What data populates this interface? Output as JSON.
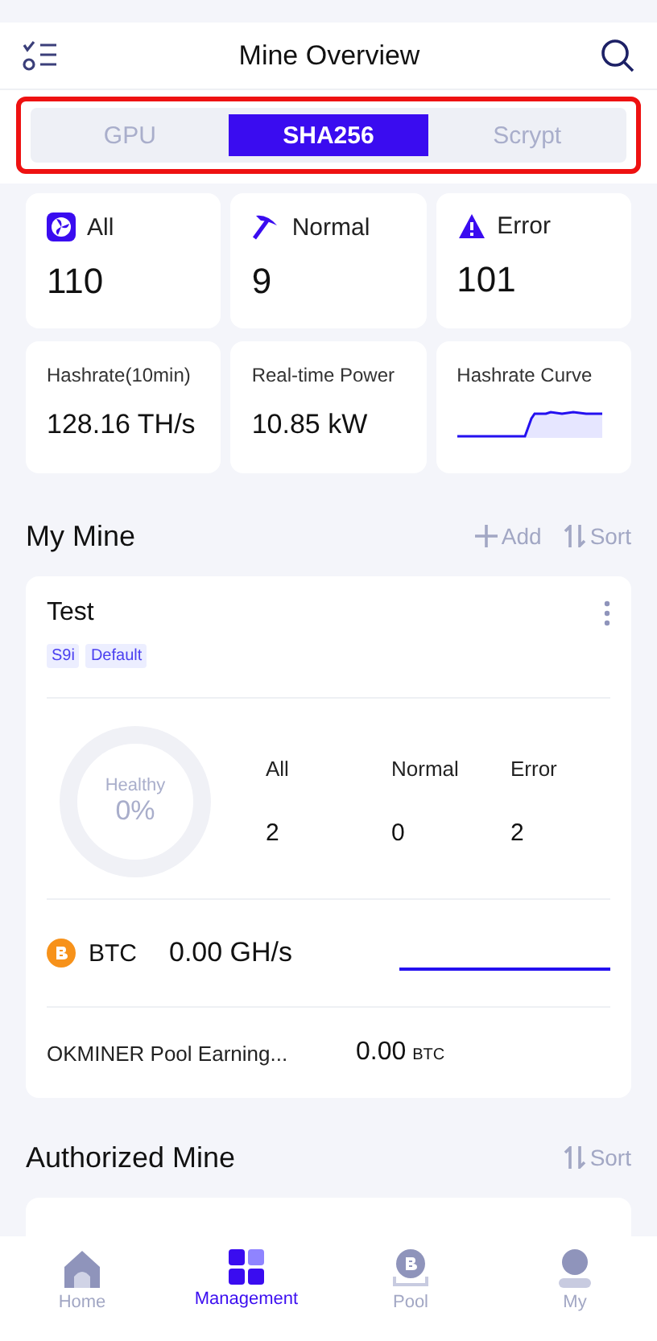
{
  "header": {
    "title": "Mine Overview"
  },
  "tabs": [
    {
      "label": "GPU",
      "selected": false
    },
    {
      "label": "SHA256",
      "selected": true
    },
    {
      "label": "Scrypt",
      "selected": false
    }
  ],
  "status_cards": [
    {
      "kind": "all",
      "label": "All",
      "value": "110"
    },
    {
      "kind": "normal",
      "label": "Normal",
      "value": "9"
    },
    {
      "kind": "error",
      "label": "Error",
      "value": "101"
    }
  ],
  "metric_cards": [
    {
      "kind": "value",
      "label": "Hashrate(10min)",
      "value": "128.16 TH/s"
    },
    {
      "kind": "value",
      "label": "Real-time Power",
      "value": "10.85 kW"
    },
    {
      "kind": "curve",
      "label": "Hashrate Curve"
    }
  ],
  "my_mine": {
    "title": "My Mine",
    "actions": [
      {
        "kind": "add",
        "label": "Add"
      },
      {
        "kind": "sort",
        "label": "Sort"
      }
    ],
    "card": {
      "name": "Test",
      "tags": [
        "S9i",
        "Default"
      ],
      "health": {
        "label": "Healthy",
        "value": "0%",
        "level": 0
      },
      "counts": [
        {
          "label": "All",
          "value": "2"
        },
        {
          "label": "Normal",
          "value": "0"
        },
        {
          "label": "Error",
          "value": "2"
        }
      ],
      "coin": {
        "name": "BTC",
        "hashrate": "0.00 GH/s"
      },
      "earnings": {
        "label": "OKMINER Pool Earning...",
        "value": "0.00",
        "unit": "BTC"
      }
    }
  },
  "authorized_mine": {
    "title": "Authorized Mine",
    "actions": [
      {
        "kind": "sort",
        "label": "Sort"
      }
    ]
  },
  "bottom_nav": [
    {
      "kind": "home",
      "label": "Home",
      "selected": false
    },
    {
      "kind": "management",
      "label": "Management",
      "selected": true
    },
    {
      "kind": "pool",
      "label": "Pool",
      "selected": false
    },
    {
      "kind": "my",
      "label": "My",
      "selected": false
    }
  ]
}
